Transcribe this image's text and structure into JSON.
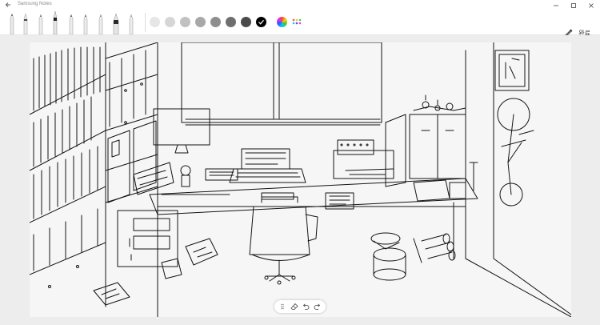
{
  "app": {
    "title": "Samsung Notes"
  },
  "toolbar": {
    "pens": [
      "pencil-1",
      "pencil-2",
      "pencil-3",
      "fountain-pen",
      "pencil-4",
      "pencil-5",
      "pencil-6",
      "brush-pen",
      "pencil-7"
    ],
    "swatches": [
      "#e6e6e6",
      "#d6d6d6",
      "#c1c1c1",
      "#a8a8a8",
      "#8e8e8e",
      "#6e6e6e",
      "#4a4a4a",
      "#000000"
    ],
    "selected_swatch_index": 7,
    "done_label": "완료"
  },
  "colors": {
    "canvas_bg": "#ededed",
    "paper": "#f6f6f6",
    "ink": "#141414"
  }
}
